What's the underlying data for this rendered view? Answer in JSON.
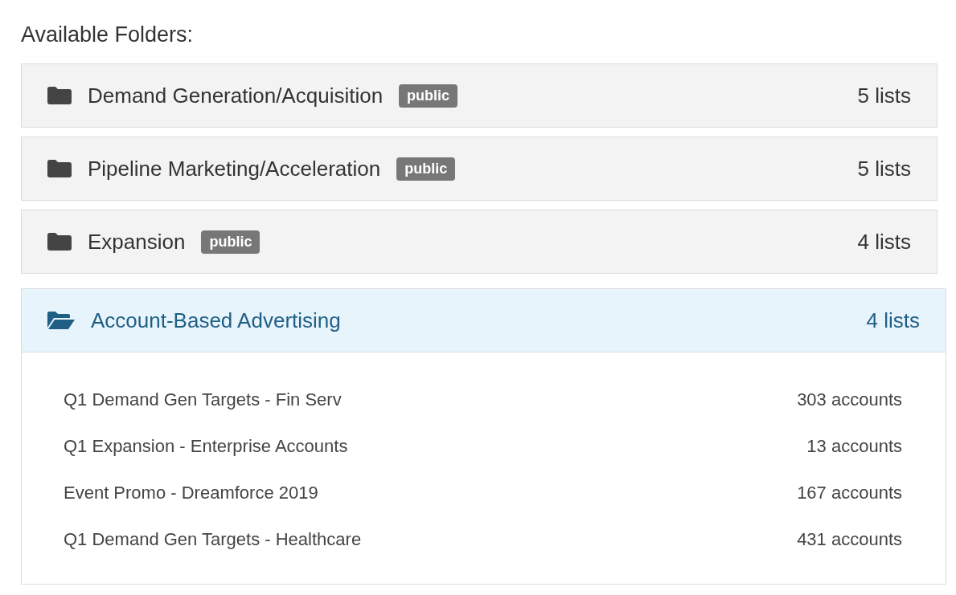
{
  "heading": "Available Folders:",
  "folders": [
    {
      "name": "Demand Generation/Acquisition",
      "badge": "public",
      "count": "5 lists",
      "expanded": false
    },
    {
      "name": "Pipeline Marketing/Acceleration",
      "badge": "public",
      "count": "5 lists",
      "expanded": false
    },
    {
      "name": "Expansion",
      "badge": "public",
      "count": "4 lists",
      "expanded": false
    },
    {
      "name": "Account-Based Advertising",
      "count": "4 lists",
      "expanded": true,
      "lists": [
        {
          "name": "Q1 Demand Gen Targets - Fin Serv",
          "count": "303 accounts"
        },
        {
          "name": "Q1 Expansion - Enterprise Accounts",
          "count": "13 accounts"
        },
        {
          "name": "Event Promo - Dreamforce 2019",
          "count": "167 accounts"
        },
        {
          "name": "Q1 Demand Gen Targets - Healthcare",
          "count": "431 accounts"
        }
      ]
    }
  ]
}
